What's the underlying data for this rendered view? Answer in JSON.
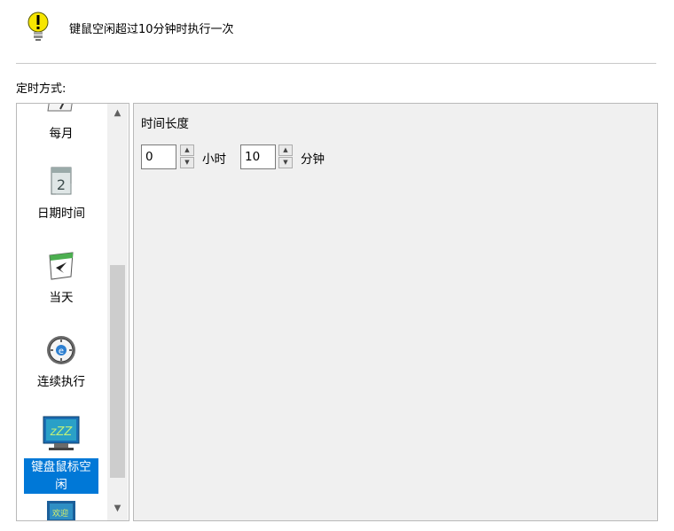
{
  "hint": {
    "text": "键鼠空闲超过10分钟时执行一次",
    "icon": "warning-bulb-icon"
  },
  "mode_label": "定时方式:",
  "list": {
    "items": [
      {
        "label": "每月",
        "icon": "calendar-month-icon"
      },
      {
        "label": "日期时间",
        "icon": "calendar-date-icon"
      },
      {
        "label": "当天",
        "icon": "calendar-today-icon"
      },
      {
        "label": "连续执行",
        "icon": "clock-icon"
      },
      {
        "label": "键盘鼠标空闲",
        "icon": "monitor-idle-icon",
        "selected": true
      },
      {
        "label": "欢迎",
        "icon": "welcome-icon"
      }
    ]
  },
  "duration": {
    "label": "时间长度",
    "hours_value": "0",
    "hours_unit": "小时",
    "minutes_value": "10",
    "minutes_unit": "分钟"
  },
  "colors": {
    "selection": "#0078d7",
    "panel_bg": "#f0f0f0"
  }
}
